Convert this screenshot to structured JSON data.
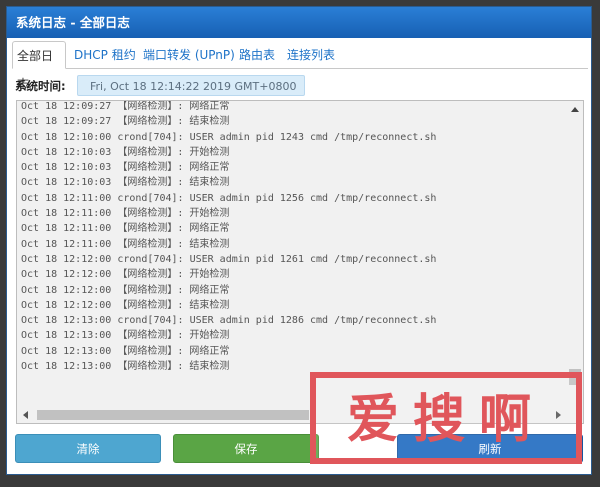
{
  "dialog": {
    "title": "系统日志 - 全部日志"
  },
  "tabs": [
    {
      "label": "全部日志",
      "active": true
    },
    {
      "label": "DHCP 租约"
    },
    {
      "label": "端口转发 (UPnP)"
    },
    {
      "label": "路由表"
    },
    {
      "label": "连接列表"
    }
  ],
  "system_time": {
    "label": "系统时间:",
    "value": "Fri, Oct 18 12:14:22 2019 GMT+0800"
  },
  "log": [
    "Oct 18 12:09:27 【网络检测】: 网络正常",
    "Oct 18 12:09:27 【网络检测】: 结束检测",
    "Oct 18 12:10:00 crond[704]: USER admin pid 1243 cmd /tmp/reconnect.sh",
    "Oct 18 12:10:03 【网络检测】: 开始检测",
    "Oct 18 12:10:03 【网络检测】: 网络正常",
    "Oct 18 12:10:03 【网络检测】: 结束检测",
    "Oct 18 12:11:00 crond[704]: USER admin pid 1256 cmd /tmp/reconnect.sh",
    "Oct 18 12:11:00 【网络检测】: 开始检测",
    "Oct 18 12:11:00 【网络检测】: 网络正常",
    "Oct 18 12:11:00 【网络检测】: 结束检测",
    "Oct 18 12:12:00 crond[704]: USER admin pid 1261 cmd /tmp/reconnect.sh",
    "Oct 18 12:12:00 【网络检测】: 开始检测",
    "Oct 18 12:12:00 【网络检测】: 网络正常",
    "Oct 18 12:12:00 【网络检测】: 结束检测",
    "Oct 18 12:13:00 crond[704]: USER admin pid 1286 cmd /tmp/reconnect.sh",
    "Oct 18 12:13:00 【网络检测】: 开始检测",
    "Oct 18 12:13:00 【网络检测】: 网络正常",
    "Oct 18 12:13:00 【网络检测】: 结束检测"
  ],
  "buttons": {
    "clear": "清除",
    "save": "保存",
    "refresh": "刷新"
  },
  "watermark": {
    "text": "爱搜啊"
  },
  "colors": {
    "title_bar": "#1e6fc6",
    "clear": "#4ea6d0",
    "save": "#5aa545",
    "refresh": "#1a67bf",
    "watermark": "#e0565b"
  }
}
